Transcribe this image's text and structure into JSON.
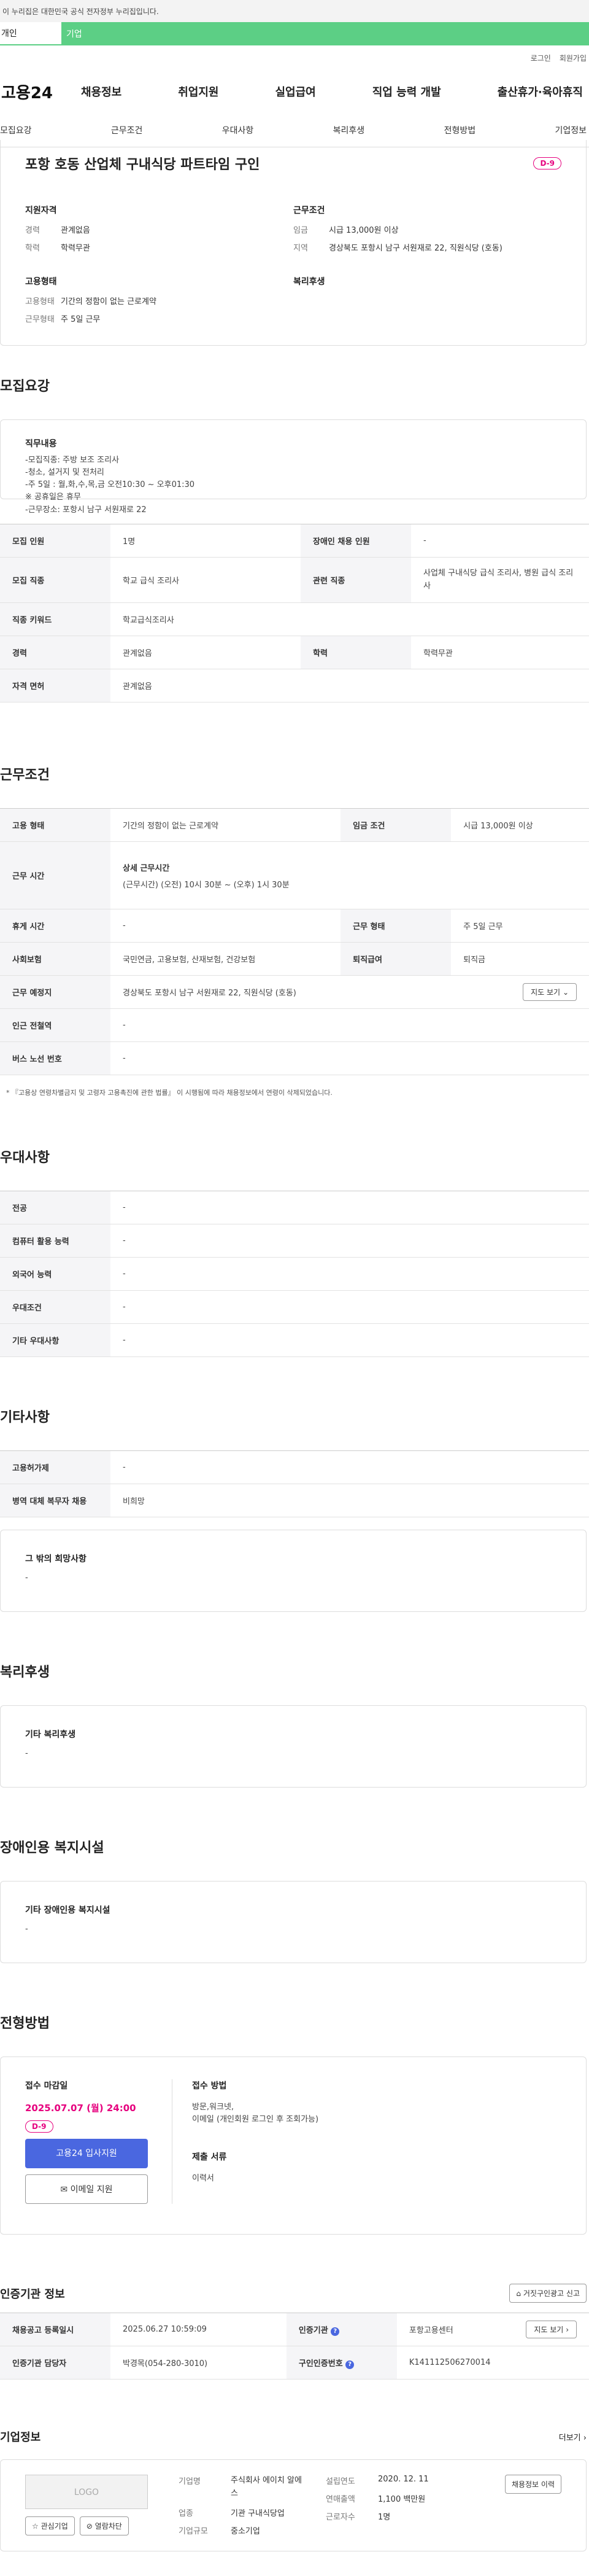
{
  "gov_banner": "이 누리집은 대한민국 공식 전자정부 누리집입니다.",
  "top_tabs": {
    "individual": "개인",
    "business": "기업"
  },
  "login_links": {
    "login": "로그인",
    "signup": "회원가입"
  },
  "logo": "고용24",
  "gnb": [
    "채용정보",
    "취업지원",
    "실업급여",
    "직업 능력 개발",
    "출산휴가·육아휴직"
  ],
  "subnav": [
    "모집요강",
    "근무조건",
    "우대사항",
    "복리후생",
    "전형방법",
    "기업정보"
  ],
  "job": {
    "title": "포항 호동 산업체 구내식당 파트타임 구인",
    "dday": "D-9",
    "qualification_title": "지원자격",
    "qualification": [
      {
        "k": "경력",
        "v": "관계없음"
      },
      {
        "k": "학력",
        "v": "학력무관"
      }
    ],
    "employment_title": "고용형태",
    "employment": [
      {
        "k": "고용형태",
        "v": "기간의 정함이 없는 근로계약"
      },
      {
        "k": "근무형태",
        "v": "주 5일 근무"
      }
    ],
    "conditions_title": "근무조건",
    "conditions": [
      {
        "k": "임금",
        "v": "시급 13,000원 이상"
      },
      {
        "k": "지역",
        "v": "경상북도 포항시 남구 서원재로 22, 직원식당 (호동)"
      }
    ],
    "welfare_title": "복리후생"
  },
  "recruit": {
    "title": "모집요강",
    "duty_title": "직무내용",
    "duty_lines": [
      "-모집직종: 주방 보조 조리사",
      "-청소, 설거지 및 전처리",
      "-주 5일 : 월,화,수,목,금 오전10:30 ~ 오후01:30",
      "※ 공휴일은 휴무",
      "-근무장소: 포항시 남구 서원재로 22"
    ],
    "rows": [
      [
        {
          "th": "모집 인원"
        },
        {
          "td": "1명"
        },
        {
          "th": "장애인 채용 인원"
        },
        {
          "td": "-"
        }
      ],
      [
        {
          "th": "모집 직종"
        },
        {
          "td": "학교 급식 조리사"
        },
        {
          "th": "관련 직종"
        },
        {
          "td": "사업체 구내식당 급식 조리사, 병원 급식 조리사"
        }
      ],
      [
        {
          "th": "직종 키워드"
        },
        {
          "td": "학교급식조리사"
        }
      ],
      [
        {
          "th": "경력"
        },
        {
          "td": "관계없음"
        },
        {
          "th": "학력"
        },
        {
          "td": "학력무관"
        }
      ],
      [
        {
          "th": "자격 면허"
        },
        {
          "td": "관계없음"
        }
      ]
    ]
  },
  "work": {
    "title": "근무조건",
    "employment_type_th": "고용 형태",
    "employment_type": "기간의 정함이 없는 근로계약",
    "wage_th": "임금 조건",
    "wage": "시급 13,000원 이상",
    "hours_th": "근무 시간",
    "hours_detail_title": "상세 근무시간",
    "hours_detail": "(근무시간) (오전) 10시 30분 ~ (오후) 1시 30분",
    "rest_th": "휴게 시간",
    "rest": "-",
    "shift_th": "근무 형태",
    "shift": "주 5일 근무",
    "insurance_th": "사회보험",
    "insurance": "국민연금, 고용보험, 산재보험, 건강보험",
    "severance_th": "퇴직급여",
    "severance": "퇴직금",
    "place_th": "근무 예정지",
    "place": "경상북도 포항시 남구 서원재로 22, 직원식당 (호동)",
    "map_btn": "지도 보기",
    "subway_th": "인근 전철역",
    "subway": "-",
    "bus_th": "버스 노선 번호",
    "bus": "-",
    "note": "* 『고용상 연령차별금지 및 고령자 고용촉진에 관한 법률』 이 시행됨에 따라 채용정보에서 연령이 삭제되었습니다."
  },
  "pref": {
    "title": "우대사항",
    "rows": [
      {
        "th": "전공",
        "td": "-"
      },
      {
        "th": "컴퓨터 활용 능력",
        "td": "-"
      },
      {
        "th": "외국어 능력",
        "td": "-"
      },
      {
        "th": "우대조건",
        "td": "-"
      },
      {
        "th": "기타 우대사항",
        "td": "-"
      }
    ]
  },
  "etc": {
    "title": "기타사항",
    "rows": [
      {
        "th": "고용허가제",
        "td": "-"
      },
      {
        "th": "병역 대체 복무자 채용",
        "td": "비희망"
      }
    ],
    "other_title": "그 밖의 희망사항",
    "other": "-"
  },
  "welfare": {
    "title": "복리후생",
    "box_title": "기타 복리후생",
    "box_value": "-"
  },
  "disabled": {
    "title": "장애인용 복지시설",
    "box_title": "기타 장애인용 복지시설",
    "box_value": "-"
  },
  "selection": {
    "title": "전형방법",
    "deadline_label": "접수 마감일",
    "deadline": "2025.07.07 (월) 24:00",
    "dday": "D-9",
    "apply_btn": "고용24 입사지원",
    "email_btn": "이메일 지원",
    "method_label": "접수 방법",
    "method_lines": [
      "방문,워크넷,",
      "이메일 (개인회원 로그인 후 조회가능)"
    ],
    "docs_label": "제출 서류",
    "docs": "이력서"
  },
  "cert": {
    "title": "인증기관 정보",
    "report_btn": "거짓구인광고 신고",
    "rows": [
      [
        {
          "th": "채용공고 등록일시"
        },
        {
          "td": "2025.06.27 10:59:09"
        },
        {
          "th": "인증기관"
        },
        {
          "td": "포항고용센터"
        }
      ],
      [
        {
          "th": "인증기관 담당자"
        },
        {
          "td": "박경목(054-280-3010)"
        },
        {
          "th": "구인인증번호"
        },
        {
          "td": "K141112506270014"
        }
      ]
    ],
    "map_btn": "지도 보기"
  },
  "company": {
    "title": "기업정보",
    "more": "더보기",
    "logo_placeholder": "LOGO",
    "fav_btn": "관심기업",
    "block_btn": "열람차단",
    "history_btn": "채용정보 이력",
    "fields": {
      "name_k": "기업명",
      "name_v": "주식회사 에이치 알에스",
      "industry_k": "업종",
      "industry_v": "기관 구내식당업",
      "size_k": "기업규모",
      "size_v": "중소기업",
      "founded_k": "설립연도",
      "founded_v": "2020. 12. 11",
      "sales_k": "연매출액",
      "sales_v": "1,100 백만원",
      "staff_k": "근로자수",
      "staff_v": "1명"
    }
  }
}
